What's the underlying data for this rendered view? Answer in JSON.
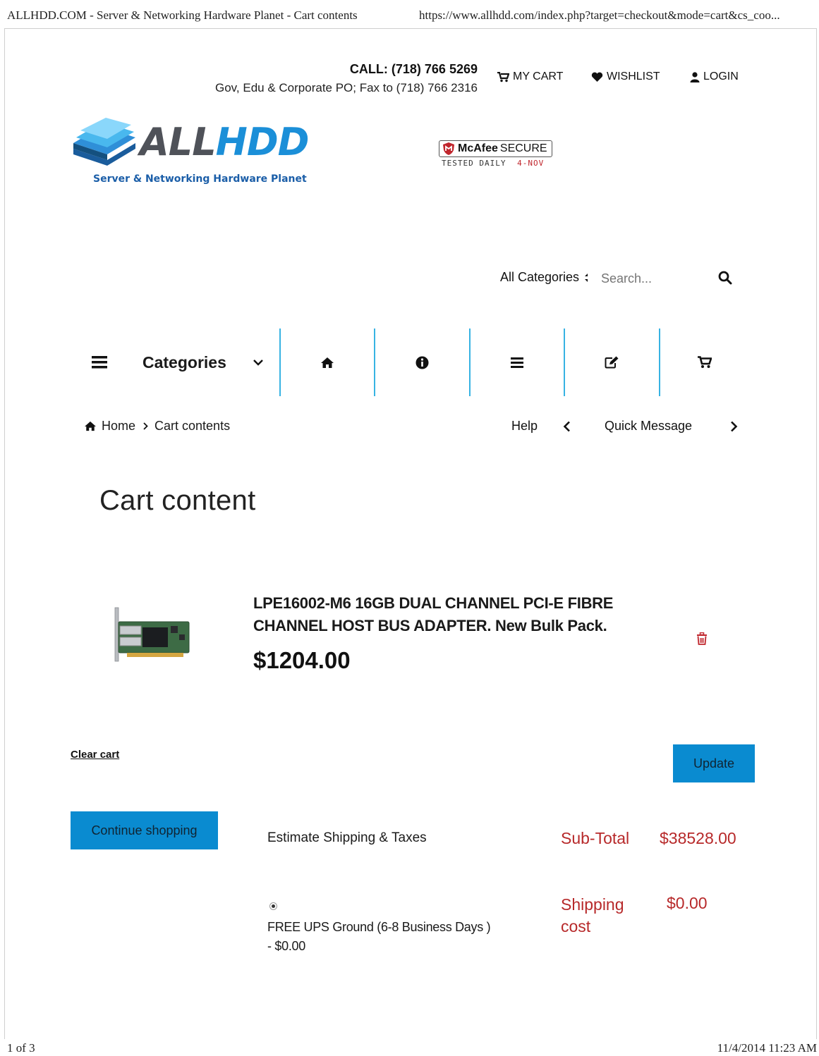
{
  "print_header": {
    "title": "ALLHDD.COM - Server & Networking Hardware Planet - Cart contents",
    "url": "https://www.allhdd.com/index.php?target=checkout&mode=cart&cs_coo..."
  },
  "print_footer": {
    "page": "1 of 3",
    "datetime": "11/4/2014 11:23 AM"
  },
  "header": {
    "call": "CALL: (718) 766 5269",
    "fax": "Gov, Edu & Corporate PO; Fax to (718) 766 2316",
    "links": {
      "cart": "MY CART",
      "wishlist": "WISHLIST",
      "login": "LOGIN"
    }
  },
  "logo": {
    "part1": "ALL",
    "part2": "HDD",
    "tagline": "Server & Networking Hardware Planet"
  },
  "mcafee": {
    "brand": "McAfee",
    "secure": "SECURE",
    "tested": "TESTED DAILY",
    "date": "4-NOV"
  },
  "search": {
    "category_label": "All Categories",
    "placeholder": "Search..."
  },
  "nav": {
    "categories_label": "Categories",
    "icons": [
      "home-icon",
      "info-icon",
      "list-icon",
      "edit-icon",
      "cart-icon"
    ]
  },
  "breadcrumb": {
    "home": "Home",
    "current": "Cart contents"
  },
  "quick_nav": {
    "help": "Help",
    "quick_message": "Quick Message"
  },
  "page_title": "Cart content",
  "cart_item": {
    "name_line1": "LPE16002-M6 16GB DUAL CHANNEL PCI-E FIBRE",
    "name_line2": "CHANNEL HOST BUS ADAPTER. New Bulk Pack.",
    "price": "$1204.00"
  },
  "actions": {
    "clear_cart": "Clear cart",
    "update": "Update",
    "continue_shopping": "Continue shopping"
  },
  "totals": {
    "estimate_label": "Estimate Shipping & Taxes",
    "subtotal_label": "Sub-Total",
    "subtotal_value": "$38528.00",
    "shipping_label_1": "Shipping",
    "shipping_label_2": "cost",
    "shipping_value": "$0.00",
    "shipping_option_line1": "FREE UPS Ground (6-8 Business Days )",
    "shipping_option_line2": "- $0.00"
  },
  "colors": {
    "accent_blue": "#0a8bd0",
    "nav_divider": "#37b3e3",
    "price_red": "#b7292a"
  }
}
